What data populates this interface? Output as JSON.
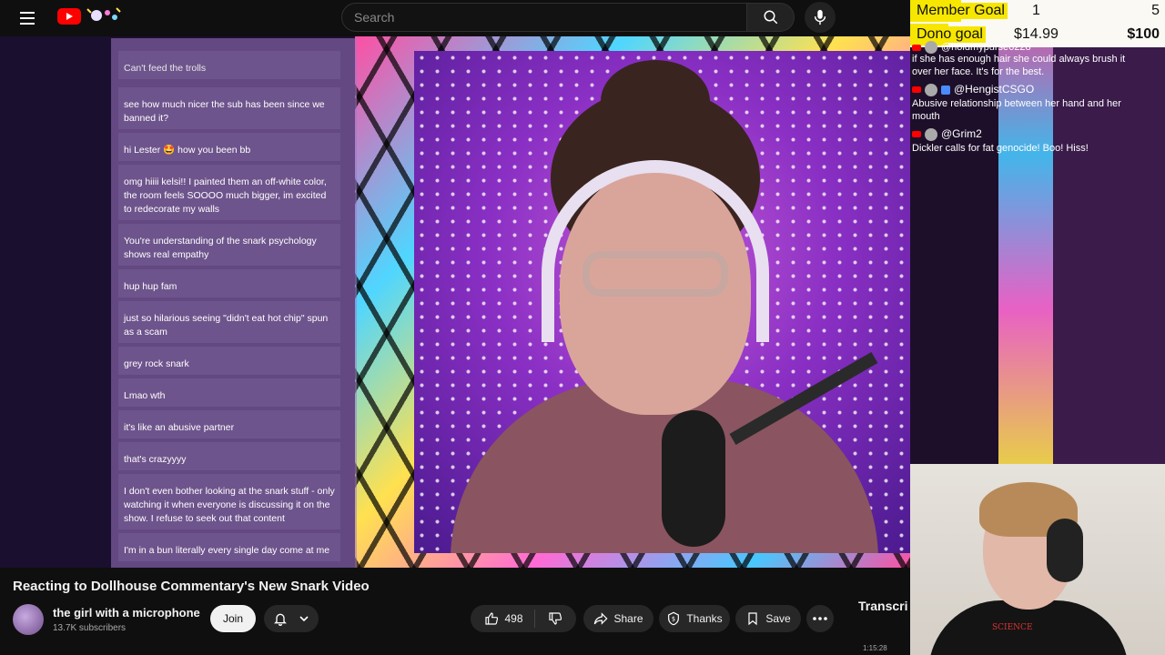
{
  "header": {
    "search_placeholder": "Search"
  },
  "chat_panel": {
    "messages": [
      {
        "user": "",
        "text": "Can't feed the trolls"
      },
      {
        "user": "",
        "text": "see how much nicer the sub has been since we banned it?"
      },
      {
        "user": "",
        "text": "hi Lester 🤩 how you been bb"
      },
      {
        "user": "",
        "text": "omg hiiii kelsi!! I painted them an off-white color, the room feels SOOOO much bigger, im excited to redecorate my walls"
      },
      {
        "user": "",
        "text": "You're understanding of the snark psychology shows real empathy"
      },
      {
        "user": "",
        "text": "hup hup fam"
      },
      {
        "user": "",
        "text": "just so hilarious seeing \"didn't eat hot chip\" spun as a scam"
      },
      {
        "user": "",
        "text": "grey rock snark"
      },
      {
        "user": "",
        "text": "Lmao wth"
      },
      {
        "user": "",
        "text": "it's like an abusive partner"
      },
      {
        "user": "",
        "text": "that's crazyyyy"
      },
      {
        "user": "",
        "text": "I don't even bother looking at the snark stuff - only watching it when everyone is discussing it on the show. I refuse to seek out that content"
      },
      {
        "user": "",
        "text": "I'm in a bun literally every single day come at me"
      }
    ]
  },
  "goals": {
    "member": {
      "label": "Member Goal",
      "current": "1",
      "target": "5",
      "progress": 0.2
    },
    "dono": {
      "label": "Dono goal",
      "current": "$14.99",
      "target": "$100",
      "progress": 0.15
    }
  },
  "yt_chat": {
    "messages": [
      {
        "user": "@holdmypurse6228",
        "text": "if she has enough hair she could always brush it over her face. It's for the best."
      },
      {
        "user": "@HengistCSGO",
        "text": "Abusive relationship between her hand and her mouth"
      },
      {
        "user": "@Grim2",
        "text": "Dickler calls for fat genocide! Boo! Hiss!"
      }
    ]
  },
  "facecam": {
    "shirt_text": "SCIENCE"
  },
  "video": {
    "title": "Reacting to Dollhouse Commentary's New Snark Video",
    "channel": "the girl with a microphone",
    "subscribers": "13.7K subscribers",
    "join_label": "Join",
    "likes": "498",
    "share_label": "Share",
    "thanks_label": "Thanks",
    "save_label": "Save",
    "transcript_label": "Transcri",
    "timestamp": "1:15:28"
  },
  "colors": {
    "goal_yellow": "#f6e600",
    "yt_red": "#ff0000",
    "page_bg": "#0f0f0f"
  }
}
